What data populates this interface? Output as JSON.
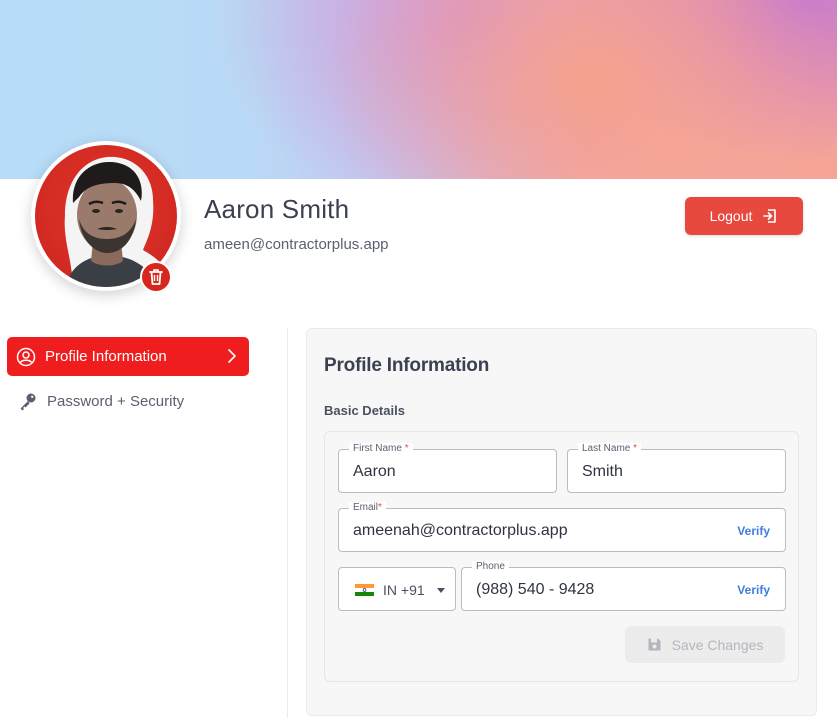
{
  "profile": {
    "name": "Aaron Smith",
    "email": "ameen@contractorplus.app"
  },
  "header": {
    "logout_label": "Logout"
  },
  "sidebar": {
    "items": [
      {
        "label": "Profile Information",
        "active": true
      },
      {
        "label": "Password + Security",
        "active": false
      }
    ]
  },
  "form": {
    "title": "Profile Information",
    "section_title": "Basic Details",
    "first_name": {
      "label": "First Name",
      "required_mark": "*",
      "value": "Aaron"
    },
    "last_name": {
      "label": "Last Name",
      "required_mark": "*",
      "value": "Smith"
    },
    "email": {
      "label": "Email",
      "required_mark": "*",
      "value": "ameenah@contractorplus.app",
      "verify_label": "Verify"
    },
    "phone": {
      "label": "Phone",
      "value": "(988) 540 - 9428",
      "verify_label": "Verify"
    },
    "country": {
      "code": "IN +91"
    },
    "save_label": "Save Changes"
  },
  "colors": {
    "accent": "#ef1d1d",
    "logout": "#e8493e",
    "verify": "#3f7de0"
  },
  "icons": [
    "trash-icon",
    "logout-icon",
    "user-circle-icon",
    "chevron-right-icon",
    "key-icon",
    "india-flag-icon",
    "caret-down-icon",
    "save-icon"
  ]
}
